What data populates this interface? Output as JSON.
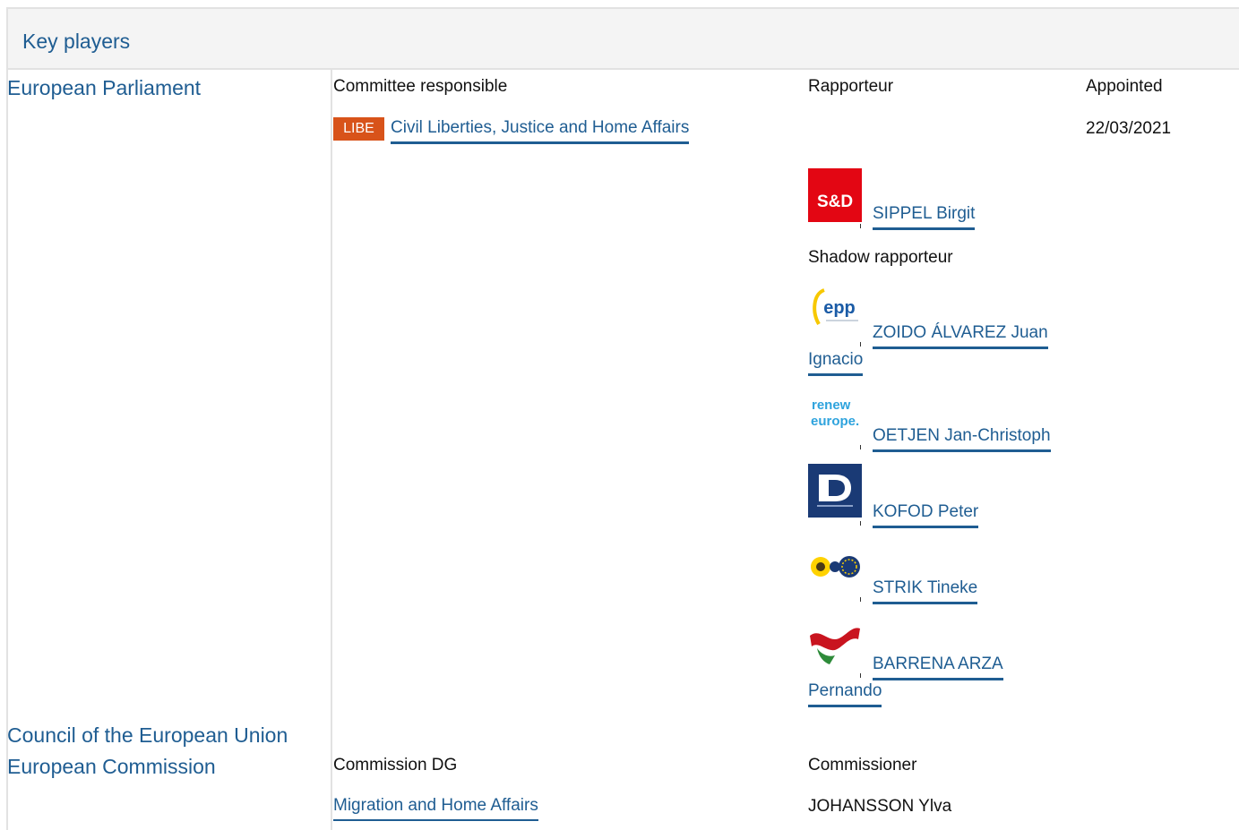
{
  "header": {
    "title": "Key players"
  },
  "institutions": {
    "parliament": "European Parliament",
    "council": "Council of the European Union",
    "commission": "European Commission"
  },
  "parliament": {
    "col_committee": "Committee responsible",
    "col_rapporteur": "Rapporteur",
    "col_appointed": "Appointed",
    "committee_abbr": "LIBE",
    "committee_name": "Civil Liberties, Justice and Home Affairs",
    "appointed_date": "22/03/2021",
    "rapporteur": {
      "group": "S&D",
      "name": "SIPPEL Birgit"
    },
    "shadow_label": "Shadow rapporteur",
    "shadows": [
      {
        "group": "epp",
        "name_line1": "ZOIDO ÁLVAREZ Juan",
        "name_line2": "Ignacio"
      },
      {
        "group": "renew europe.",
        "name": "OETJEN Jan-Christoph"
      },
      {
        "group": "ID",
        "name": "KOFOD Peter"
      },
      {
        "group": "Greens/EFA",
        "name": "STRIK Tineke"
      },
      {
        "group": "GUE/NGL",
        "name_line1": "BARRENA ARZA",
        "name_line2": "Pernando"
      }
    ]
  },
  "commission": {
    "col_dg": "Commission DG",
    "col_commissioner": "Commissioner",
    "dg_name": "Migration and Home Affairs",
    "commissioner": "JOHANSSON Ylva"
  },
  "colors": {
    "link": "#1f5d92",
    "badge": "#d8531a",
    "sd_red": "#e30613"
  }
}
